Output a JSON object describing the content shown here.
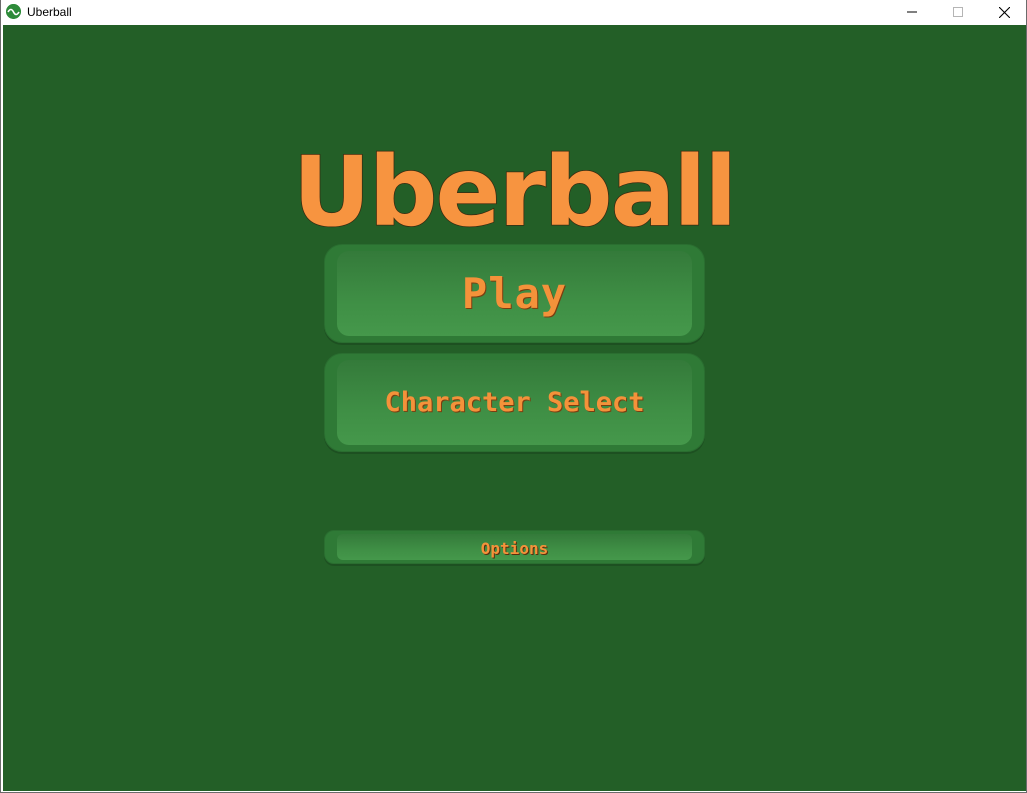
{
  "window": {
    "title": "Uberball",
    "controls": {
      "minimize_icon": "minimize-icon",
      "maximize_icon": "maximize-icon",
      "close_icon": "close-icon"
    }
  },
  "game": {
    "logo_text": "Uberball",
    "menu": {
      "play_label": "Play",
      "character_select_label": "Character Select",
      "options_label": "Options"
    }
  },
  "colors": {
    "background": "#235f27",
    "button": "#2f7a36",
    "label": "#f4923a",
    "logo": "#f79440"
  }
}
